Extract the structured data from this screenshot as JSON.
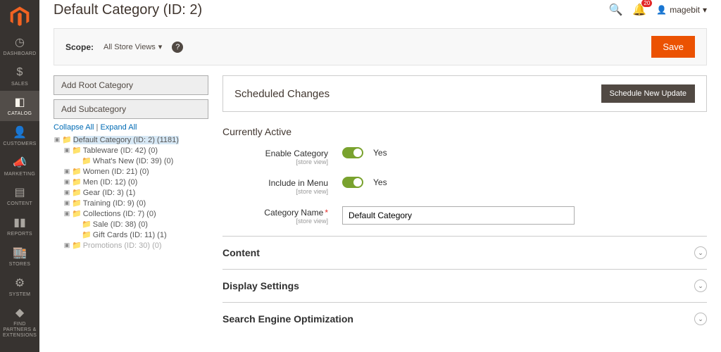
{
  "sidebar": {
    "items": [
      {
        "label": "DASHBOARD"
      },
      {
        "label": "SALES"
      },
      {
        "label": "CATALOG"
      },
      {
        "label": "CUSTOMERS"
      },
      {
        "label": "MARKETING"
      },
      {
        "label": "CONTENT"
      },
      {
        "label": "REPORTS"
      },
      {
        "label": "STORES"
      },
      {
        "label": "SYSTEM"
      },
      {
        "label": "FIND PARTNERS & EXTENSIONS"
      }
    ]
  },
  "header": {
    "title": "Default Category (ID: 2)",
    "notification_count": "20",
    "username": "magebit"
  },
  "scope": {
    "label": "Scope:",
    "value": "All Store Views",
    "save": "Save"
  },
  "left": {
    "add_root": "Add Root Category",
    "add_sub": "Add Subcategory",
    "collapse": "Collapse All",
    "expand": "Expand All"
  },
  "tree": {
    "root": "Default Category (ID: 2) (1181)",
    "n1": "Tableware (ID: 42) (0)",
    "n1a": "What's New (ID: 39) (0)",
    "n2": "Women (ID: 21) (0)",
    "n3": "Men (ID: 12) (0)",
    "n4": "Gear (ID: 3) (1)",
    "n5": "Training (ID: 9) (0)",
    "n6": "Collections (ID: 7) (0)",
    "n6a": "Sale (ID: 38) (0)",
    "n6b": "Gift Cards (ID: 11) (1)",
    "n7": "Promotions (ID: 30) (0)"
  },
  "scheduled": {
    "title": "Scheduled Changes",
    "button": "Schedule New Update"
  },
  "section": {
    "title": "Currently Active"
  },
  "form": {
    "enable_label": "Enable Category",
    "enable_hint": "[store view]",
    "enable_val": "Yes",
    "menu_label": "Include in Menu",
    "menu_hint": "[store view]",
    "menu_val": "Yes",
    "name_label": "Category Name",
    "name_hint": "[store view]",
    "name_val": "Default Category"
  },
  "fieldsets": {
    "content": "Content",
    "display": "Display Settings",
    "seo": "Search Engine Optimization"
  }
}
